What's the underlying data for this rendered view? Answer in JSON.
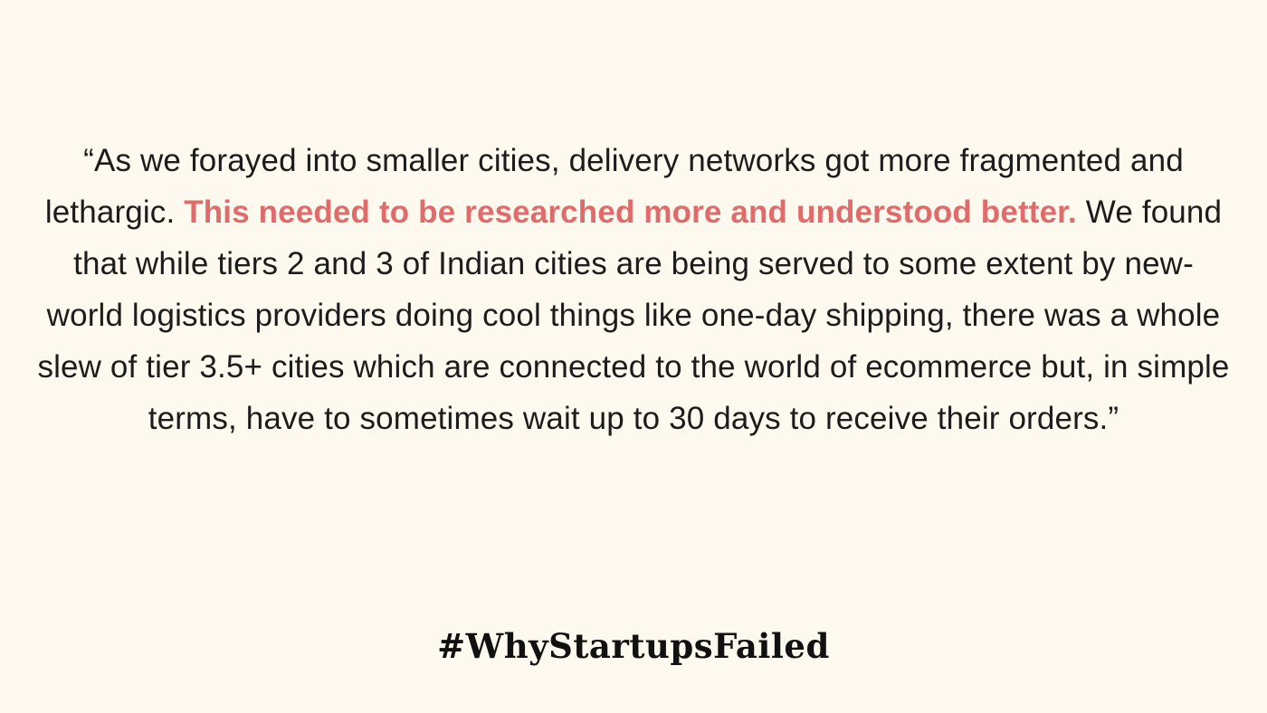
{
  "quote": {
    "part1": "“As we forayed into smaller cities, delivery networks got more fragmented and lethargic. ",
    "highlight": "This needed to be researched more and understood better.",
    "part2": " We found that while tiers 2 and 3 of Indian cities are being served to some extent by new-world logistics providers doing cool things like one-day shipping, there was a whole slew of tier 3.5+ cities which are connected to the world of ecommerce but, in simple terms, have to sometimes wait up to 30 days to receive their orders.”"
  },
  "hashtag": "#WhyStartupsFailed",
  "colors": {
    "background": "#fdf9ee",
    "text": "#1c1c1c",
    "highlight": "#e06b6b"
  }
}
